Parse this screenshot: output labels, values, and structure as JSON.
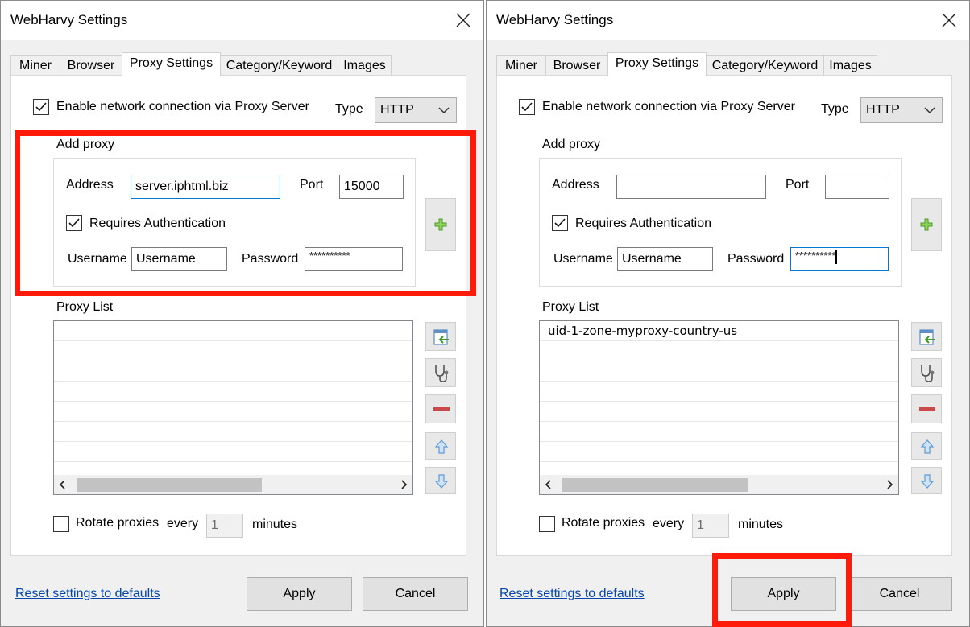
{
  "left": {
    "title": "WebHarvy Settings",
    "tabs": [
      "Miner",
      "Browser",
      "Proxy Settings",
      "Category/Keyword",
      "Images"
    ],
    "active_tab": "Proxy Settings",
    "enable_proxy_label": "Enable network connection via Proxy Server",
    "enable_proxy_checked": true,
    "type_label": "Type",
    "type_value": "HTTP",
    "add_proxy_label": "Add proxy",
    "address_label": "Address",
    "address_value": "server.iphtml.biz",
    "port_label": "Port",
    "port_value": "15000",
    "requires_auth_label": "Requires Authentication",
    "requires_auth_checked": true,
    "username_label": "Username",
    "username_value": "Username",
    "password_label": "Password",
    "password_value": "**********",
    "proxy_list_label": "Proxy List",
    "proxy_list_items": [],
    "rotate_label": "Rotate proxies",
    "every_label": "every",
    "every_value": "1",
    "minutes_label": "minutes",
    "reset_link": "Reset settings to defaults",
    "apply_label": "Apply",
    "cancel_label": "Cancel"
  },
  "right": {
    "title": "WebHarvy Settings",
    "tabs": [
      "Miner",
      "Browser",
      "Proxy Settings",
      "Category/Keyword",
      "Images"
    ],
    "active_tab": "Proxy Settings",
    "enable_proxy_label": "Enable network connection via Proxy Server",
    "enable_proxy_checked": true,
    "type_label": "Type",
    "type_value": "HTTP",
    "add_proxy_label": "Add proxy",
    "address_label": "Address",
    "address_value": "",
    "port_label": "Port",
    "port_value": "",
    "requires_auth_label": "Requires Authentication",
    "requires_auth_checked": true,
    "username_label": "Username",
    "username_value": "Username",
    "password_label": "Password",
    "password_value": "**********",
    "proxy_list_label": "Proxy List",
    "proxy_list_items": [
      "uid-1-zone-myproxy-country-us"
    ],
    "rotate_label": "Rotate proxies",
    "every_label": "every",
    "every_value": "1",
    "minutes_label": "minutes",
    "reset_link": "Reset settings to defaults",
    "apply_label": "Apply",
    "cancel_label": "Cancel"
  },
  "colors": {
    "highlight": "#ff1a0a",
    "link": "#0645ad",
    "focus_border": "#0078d7",
    "add_icon_green": "#5cb82e",
    "remove_icon_red": "#c84a4a",
    "arrow_icon_blue": "#5b9bd5"
  },
  "icons": {
    "close": "close-icon",
    "add": "plus-icon",
    "import": "import-icon",
    "test": "stethoscope-icon",
    "remove": "minus-icon",
    "move_up": "arrow-up-icon",
    "move_down": "arrow-down-icon",
    "dropdown": "chevron-down-icon"
  }
}
